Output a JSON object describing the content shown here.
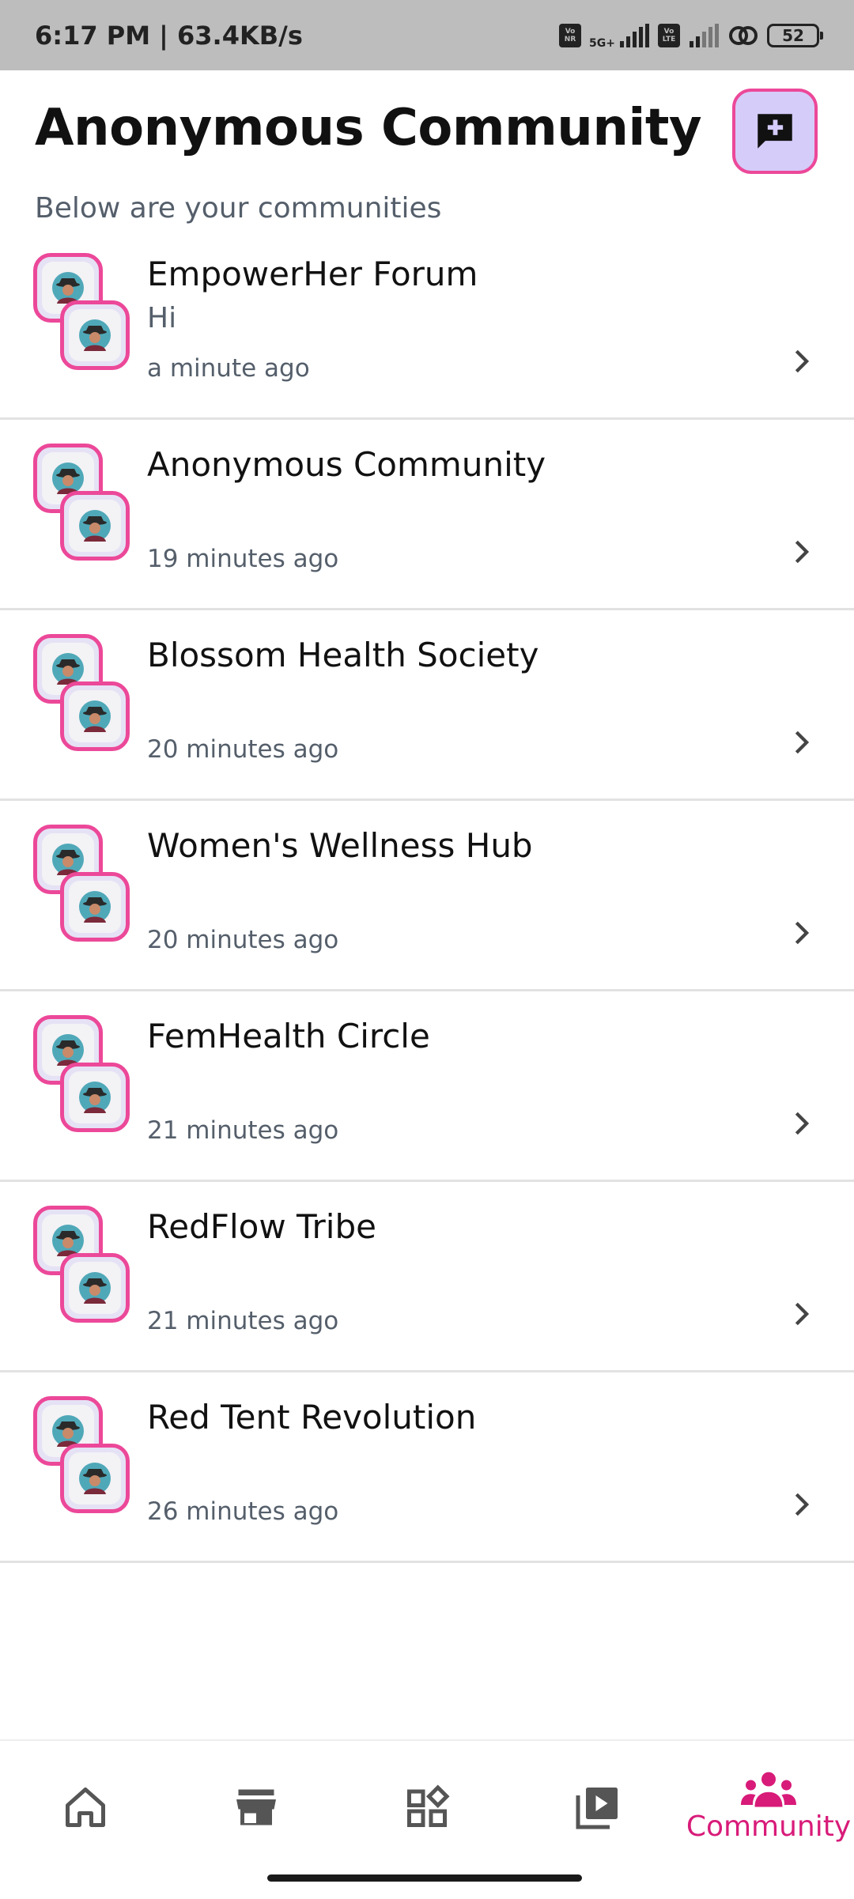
{
  "status_bar": {
    "time_speed": "6:17 PM | 63.4KB/s",
    "sim1_badge_top": "Vo",
    "sim1_badge_bottom": "NR",
    "network_label": "5G+",
    "sim2_badge_top": "Vo",
    "sim2_badge_bottom": "LTE",
    "battery": "52"
  },
  "header": {
    "title": "Anonymous Community",
    "subtitle": "Below are your communities",
    "new_chat_icon": "add-comment-icon"
  },
  "communities": [
    {
      "name": "EmpowerHer Forum",
      "last_message": "Hi",
      "time": "a minute ago"
    },
    {
      "name": "Anonymous Community",
      "last_message": "",
      "time": "19 minutes ago"
    },
    {
      "name": "Blossom Health Society",
      "last_message": "",
      "time": "20 minutes ago"
    },
    {
      "name": "Women's Wellness Hub",
      "last_message": "",
      "time": "20 minutes ago"
    },
    {
      "name": "FemHealth Circle",
      "last_message": "",
      "time": "21 minutes ago"
    },
    {
      "name": "RedFlow Tribe",
      "last_message": "",
      "time": "21 minutes ago"
    },
    {
      "name": "Red Tent Revolution",
      "last_message": "",
      "time": "26 minutes ago"
    }
  ],
  "bottom_nav": [
    {
      "icon": "home-icon",
      "label": ""
    },
    {
      "icon": "store-icon",
      "label": ""
    },
    {
      "icon": "widgets-icon",
      "label": ""
    },
    {
      "icon": "video-library-icon",
      "label": ""
    },
    {
      "icon": "groups-icon",
      "label": "Community",
      "active": true
    }
  ],
  "colors": {
    "accent_pink": "#ec4899",
    "nav_active": "#d81b79",
    "button_bg": "#d5ccfa",
    "text_secondary": "#555f6b"
  }
}
